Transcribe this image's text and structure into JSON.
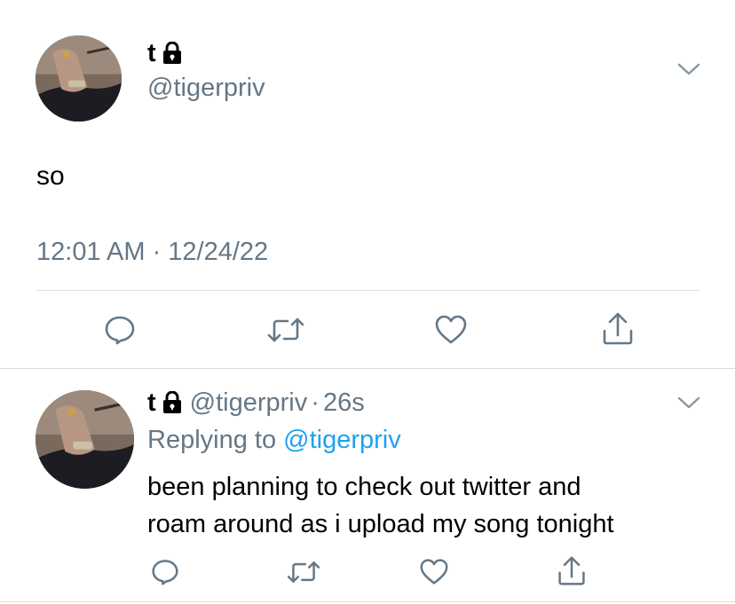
{
  "main_tweet": {
    "display_name": "t",
    "handle": "@tigerpriv",
    "text": "so",
    "timestamp": "12:01 AM · 12/24/22"
  },
  "reply_tweet": {
    "display_name": "t",
    "handle": "@tigerpriv",
    "dot": "·",
    "age": "26s",
    "replying_prefix": "Replying to",
    "replying_handle": "@tigerpriv",
    "text_line1": "been planning to check out twitter and",
    "text_line2": "roam around as i upload my song tonight"
  },
  "icons": {
    "protected": "lock-icon",
    "more": "chevron-down-icon",
    "reply": "reply-icon",
    "retweet": "retweet-icon",
    "like": "heart-icon",
    "share": "share-icon"
  },
  "colors": {
    "secondary_text": "#657786",
    "link": "#1da1f2",
    "divider": "#d9dde1",
    "icon": "#657786"
  }
}
